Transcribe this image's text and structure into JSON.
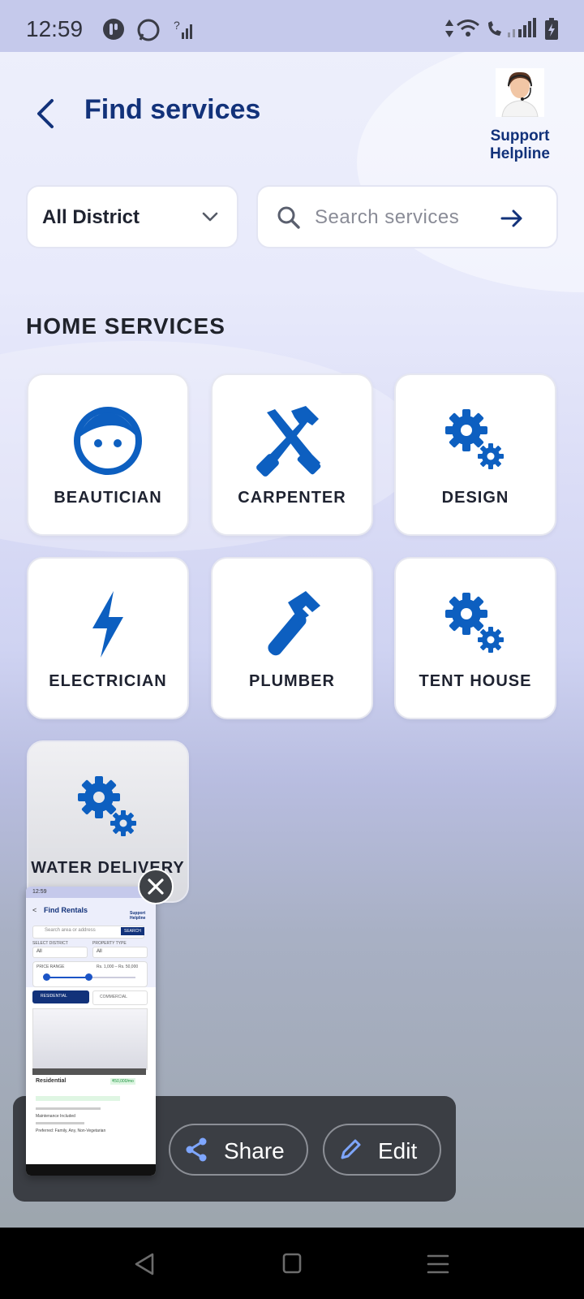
{
  "status_bar": {
    "time": "12:59"
  },
  "header": {
    "title": "Find services",
    "support_label_line1": "Support",
    "support_label_line2": "Helpline"
  },
  "filters": {
    "district_value": "All District",
    "search_placeholder": "Search services"
  },
  "section": {
    "title": "HOME SERVICES"
  },
  "services": [
    {
      "label": "BEAUTICIAN",
      "icon": "face-icon"
    },
    {
      "label": "CARPENTER",
      "icon": "tools-icon"
    },
    {
      "label": "DESIGN",
      "icon": "gears-icon"
    },
    {
      "label": "ELECTRICIAN",
      "icon": "bolt-icon"
    },
    {
      "label": "PLUMBER",
      "icon": "wrench-icon"
    },
    {
      "label": "TENT HOUSE",
      "icon": "gears-icon"
    },
    {
      "label": "WATER DELIVERY",
      "icon": "gears-icon"
    }
  ],
  "screenshot_preview": {
    "time": "12:59",
    "title": "Find Rentals",
    "support": "Support Helpline",
    "search_placeholder": "Search area or address",
    "search_button": "SEARCH",
    "district_label": "SELECT DISTRICT",
    "district_value": "All",
    "type_label": "PROPERTY TYPE",
    "type_value": "All",
    "price_label": "PRICE RANGE",
    "price_value": "Rs. 1,000 – Rs. 50,000",
    "tab_residential": "RESIDENTIAL",
    "tab_commercial": "COMMERCIAL",
    "listing_title": "Residential",
    "listing_price": "₹50,000/mo",
    "listing_detail": "Maintenance Included",
    "listing_note": "Preferred: Family, Any, Non-Vegetarian"
  },
  "share_toolbar": {
    "share_label": "Share",
    "edit_label": "Edit"
  },
  "colors": {
    "brand": "#12327a",
    "icon_blue": "#0d5fc0"
  }
}
